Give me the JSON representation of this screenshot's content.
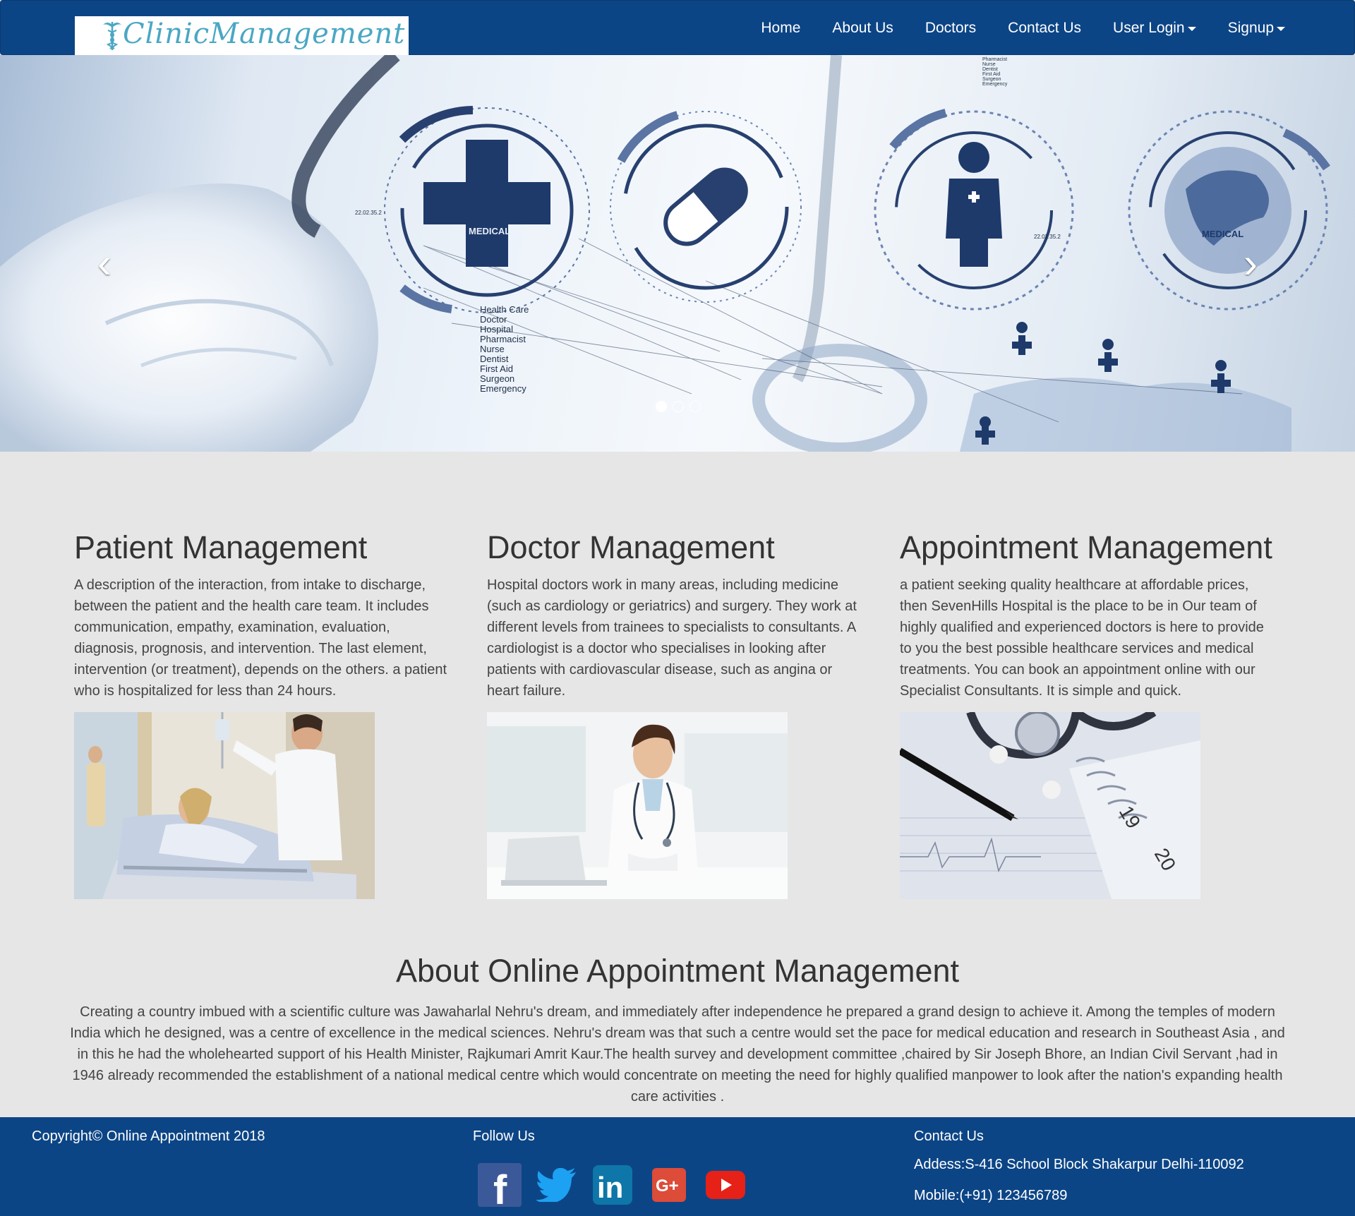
{
  "brand": {
    "logo_text": "ClinicManagement"
  },
  "nav": {
    "items": [
      {
        "label": "Home"
      },
      {
        "label": "About Us"
      },
      {
        "label": "Doctors"
      },
      {
        "label": "Contact Us"
      },
      {
        "label": "User Login"
      },
      {
        "label": "Signup"
      }
    ]
  },
  "hero": {
    "prev_glyph": "‹",
    "next_glyph": "›",
    "slide_count": 3,
    "active_slide": 1,
    "label_medical": "MEDICAL",
    "label_date": "22.02.35.2",
    "list_items": [
      "Health Care",
      "Doctor",
      "Hospital",
      "Pharmacist",
      "Nurse",
      "Dentist",
      "First Aid",
      "Surgeon",
      "Emergency"
    ],
    "small_list_items": [
      "Pharmacist",
      "Nurse",
      "Dentist",
      "First Aid",
      "Surgeon",
      "Emergency"
    ]
  },
  "features": [
    {
      "title": "Patient Management",
      "text": "A description of the interaction, from intake to discharge, between the patient and the health care team. It includes communication, empathy, examination, evaluation, diagnosis, prognosis, and intervention. The last element, intervention (or treatment), depends on the others. a patient who is hospitalized for less than 24 hours."
    },
    {
      "title": "Doctor Management",
      "text": "Hospital doctors work in many areas, including medicine (such as cardiology or geriatrics) and surgery. They work at different levels from trainees to specialists to consultants. A cardiologist is a doctor who specialises in looking after patients with cardiovascular disease, such as angina or heart failure."
    },
    {
      "title": "Appointment Management",
      "text": "a patient seeking quality healthcare at affordable prices, then SevenHills Hospital is the place to be in Our team of highly qualified and experienced doctors is here to provide to you the best possible healthcare services and medical treatments. You can book an appointment online with our Specialist Consultants. It is simple and quick."
    }
  ],
  "about": {
    "title": "About Online Appointment Management",
    "text": "Creating a country imbued with a scientific culture was Jawaharlal Nehru's dream, and immediately after independence he prepared a grand design to achieve it. Among the temples of modern India which he designed, was a centre of excellence in the medical sciences. Nehru's dream was that such a centre would set the pace for medical education and research in Southeast Asia , and in this he had the wholehearted support of his Health Minister, Rajkumari Amrit Kaur.The health survey and development committee ,chaired by Sir Joseph Bhore, an Indian Civil Servant ,had in 1946 already recommended the establishment of a national medical centre which would concentrate on meeting the need for highly qualified manpower to look after the nation's expanding health care activities ."
  },
  "footer": {
    "copyright": "Copyright© Online Appointment 2018",
    "follow_title": "Follow Us",
    "social": [
      {
        "name": "facebook-icon",
        "glyph": "f",
        "color": "#3b5998"
      },
      {
        "name": "twitter-icon",
        "glyph": "",
        "color": "#1da1f2"
      },
      {
        "name": "linkedin-icon",
        "glyph": "in",
        "color": "#0e76a8"
      },
      {
        "name": "google-plus-icon",
        "glyph": "G+",
        "color": "#dd4b39"
      },
      {
        "name": "youtube-icon",
        "glyph": "",
        "color": "#e62117"
      }
    ],
    "contact_title": "Contact Us",
    "address": "Addess:S-416 School Block Shakarpur Delhi-110092",
    "mobile": "Mobile:(+91) 123456789"
  },
  "colors": {
    "primary": "#0c4586",
    "page_bg": "#e6e6e6",
    "hero_accent": "#2d4a82",
    "logo_text": "#4aa7c4"
  }
}
